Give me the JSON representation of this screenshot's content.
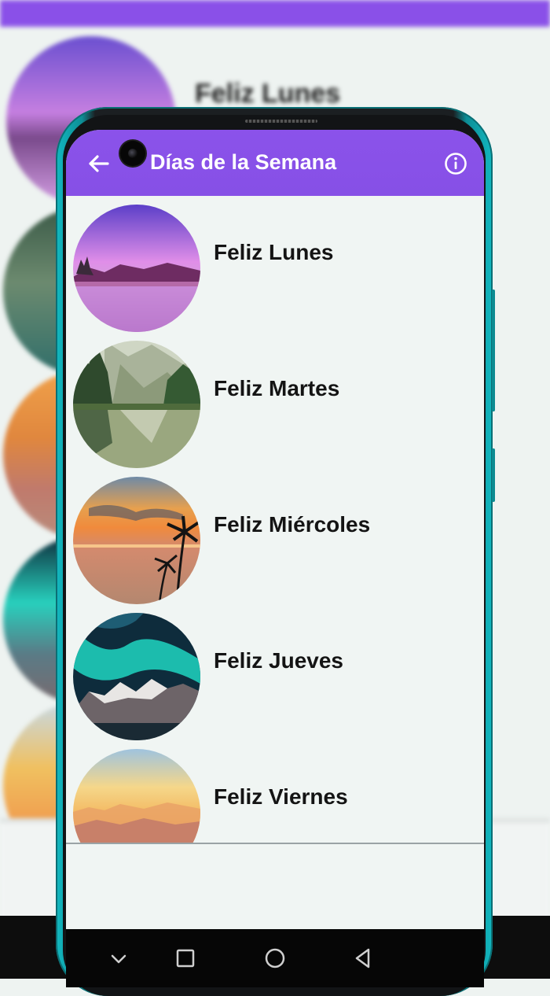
{
  "app": {
    "title": "Días de la Semana",
    "back_icon": "arrow-left-icon",
    "info_icon": "info-circle-icon",
    "appbar_color": "#8a51e8"
  },
  "days": [
    {
      "label": "Feliz Lunes",
      "image": "purple-lake-sunset"
    },
    {
      "label": "Feliz Martes",
      "image": "mountain-lake-forest"
    },
    {
      "label": "Feliz Miércoles",
      "image": "tropical-sunset-palms"
    },
    {
      "label": "Feliz Jueves",
      "image": "aurora-snowy-mountain"
    },
    {
      "label": "Feliz Viernes",
      "image": "golden-mountain-haze"
    }
  ],
  "background": {
    "blurred_title": "Feliz Lunes"
  },
  "navigation": {
    "buttons": [
      "chevron-down-icon",
      "square-icon",
      "circle-icon",
      "triangle-back-icon"
    ]
  }
}
